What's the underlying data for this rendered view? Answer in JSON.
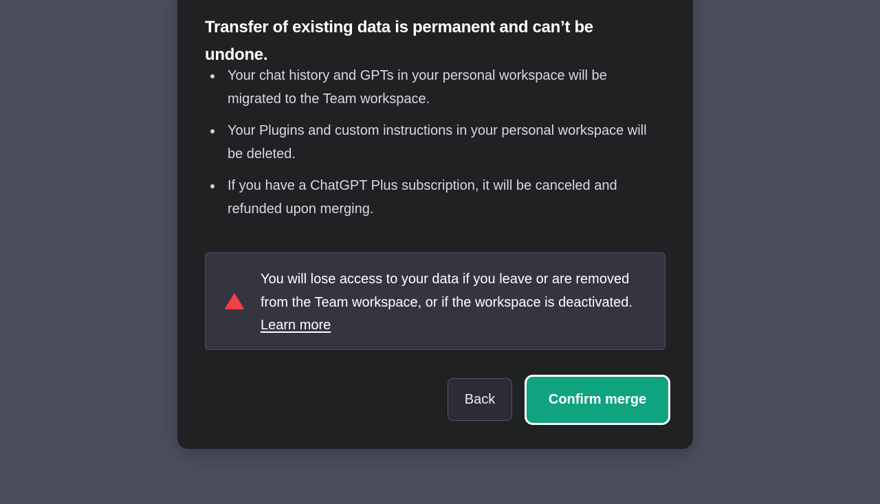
{
  "dialog": {
    "heading": "Transfer of existing data is permanent and can’t be undone.",
    "bullets": [
      "Your chat history and GPTs in your personal workspace will be migrated to the Team workspace.",
      "Your Plugins and custom instructions in your personal workspace will be deleted.",
      "If you have a ChatGPT Plus subscription, it will be canceled and refunded upon merging."
    ],
    "warning": {
      "icon": "warning-triangle-icon",
      "text": "You will lose access to your data if you leave or are removed from the Team workspace, or if the workspace is deactivated.",
      "link_label": "Learn more"
    },
    "buttons": {
      "back": "Back",
      "confirm": "Confirm merge"
    }
  },
  "colors": {
    "backdrop": "#4c4e5d",
    "modal_bg": "#202123",
    "warning_bg": "#343541",
    "warning_icon": "#ef4146",
    "accent": "#10a37f"
  }
}
